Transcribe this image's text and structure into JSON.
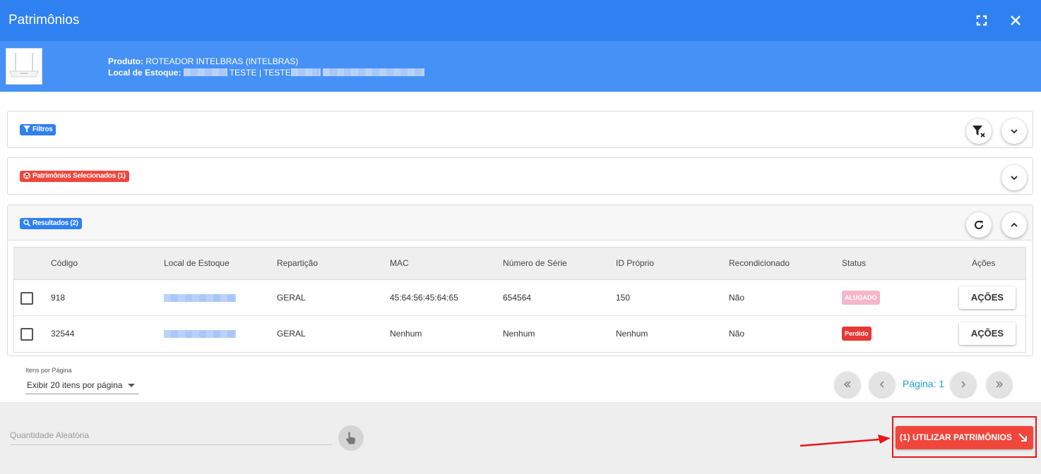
{
  "window": {
    "title": "Patrimônios"
  },
  "product": {
    "product_label": "Produto:",
    "product_value": "ROTEADOR INTELBRAS (INTELBRAS)",
    "location_label": "Local de Estoque:",
    "location_value": "TESTE | TESTE"
  },
  "filters": {
    "label": "Filtros"
  },
  "selected": {
    "label": "Patrimônios Selecionados (1)"
  },
  "results": {
    "label": "Resultados (2)",
    "columns": [
      "Código",
      "Local de Estoque",
      "Repartição",
      "MAC",
      "Número de Série",
      "ID Próprio",
      "Recondicionado",
      "Status",
      "Ações"
    ],
    "rows": [
      {
        "codigo": "918",
        "reparticao": "GERAL",
        "mac": "45:64:56:45:64:65",
        "serie": "654564",
        "id_proprio": "150",
        "recondicionado": "Não",
        "status": "ALUGADO",
        "status_color": "#f4b6c8",
        "acoes": "AÇÕES"
      },
      {
        "codigo": "32544",
        "reparticao": "GERAL",
        "mac": "Nenhum",
        "serie": "Nenhum",
        "id_proprio": "Nenhum",
        "recondicionado": "Não",
        "status": "Perdido",
        "status_color": "#e53935",
        "acoes": "AÇÕES"
      }
    ]
  },
  "pagination": {
    "per_page_label": "Itens por Página",
    "per_page_value": "Exibir 20 itens por página",
    "page_label": "Página: 1"
  },
  "bottom": {
    "quantity_placeholder": "Quantidade Aleatória",
    "use_button": "(1) UTILIZAR PATRIMÔNIOS"
  },
  "colors": {
    "header_blue": "#2f80f0",
    "product_blue": "#4691f6",
    "badge_blue": "#2f80f0",
    "badge_red": "#f0463b",
    "annotation_red": "#e8141c"
  },
  "icons": [
    "fullscreen-icon",
    "close-icon",
    "router-image",
    "filter-icon",
    "clear-filter-icon",
    "chevron-down-icon",
    "cube-icon",
    "search-icon",
    "refresh-icon",
    "chevron-up-icon",
    "first-page-icon",
    "prev-page-icon",
    "next-page-icon",
    "last-page-icon",
    "hand-pointer-icon",
    "arrow-down-right-icon"
  ]
}
